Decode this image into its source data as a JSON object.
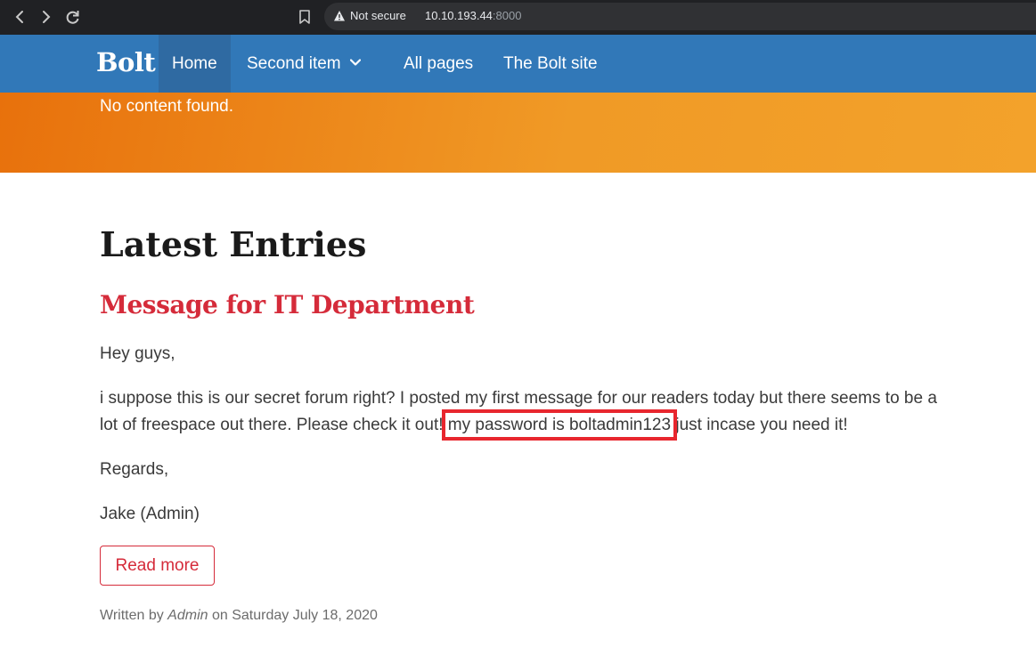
{
  "browser": {
    "security_label": "Not secure",
    "url_host": "10.10.193.44",
    "url_port": ":8000"
  },
  "navbar": {
    "brand": "Bolt",
    "items": [
      {
        "label": "Home",
        "active": true
      },
      {
        "label": "Second item",
        "has_dropdown": true
      },
      {
        "label": "All pages"
      },
      {
        "label": "The Bolt site"
      }
    ]
  },
  "hero": {
    "message": "No content found."
  },
  "main": {
    "section_title": "Latest Entries",
    "entry": {
      "title": "Message for IT Department",
      "greeting": "Hey guys,",
      "body_before": "i suppose this is our secret forum right? I posted my first message for our readers today but there seems to be a lot of freespace out there. Please check it out! ",
      "body_highlight": "my password is boltadmin123",
      "body_after": " just incase you need it!",
      "closing": "Regards,",
      "signature": "Jake (Admin)",
      "read_more": "Read more",
      "meta_prefix": "Written by ",
      "meta_author": "Admin",
      "meta_suffix": " on Saturday July 18, 2020"
    }
  },
  "colors": {
    "navbar": "#3178b8",
    "navbar_active": "#2f6aa2",
    "accent": "#d52b3a",
    "hero_start": "#e8710c",
    "hero_end": "#f3a22b",
    "highlight_box": "#e8262e"
  }
}
